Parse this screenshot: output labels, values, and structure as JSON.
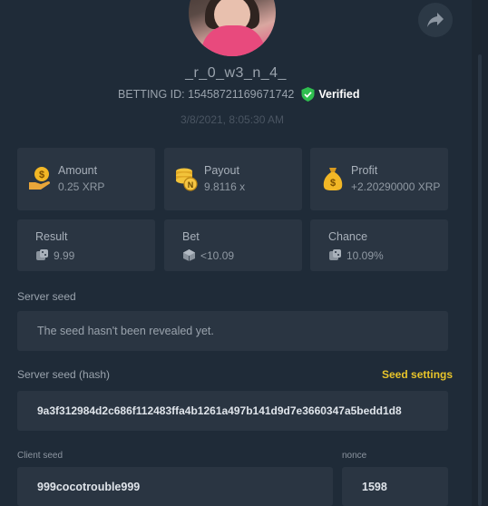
{
  "profile": {
    "username": "_r_0_w3_n_4_",
    "betting_id": "BETTING ID: 15458721169671742",
    "verified_label": "Verified",
    "timestamp": "3/8/2021, 8:05:30 AM"
  },
  "stats": {
    "amount": {
      "label": "Amount",
      "value": "0.25 XRP",
      "icon": "money-bag-hand-icon"
    },
    "payout": {
      "label": "Payout",
      "value": "9.8116 x",
      "icon": "coin-stack-icon"
    },
    "profit": {
      "label": "Profit",
      "value": "+2.20290000 XRP",
      "icon": "money-sack-icon"
    },
    "result": {
      "label": "Result",
      "value": "9.99",
      "icon": "dice-icon"
    },
    "bet": {
      "label": "Bet",
      "value": "<10.09",
      "icon": "cube-icon"
    },
    "chance": {
      "label": "Chance",
      "value": "10.09%",
      "icon": "dice-icon"
    }
  },
  "server_seed": {
    "label": "Server seed",
    "value": "The seed hasn't been revealed yet."
  },
  "server_seed_hash": {
    "label": "Server seed (hash)",
    "settings_link": "Seed settings",
    "value": "9a3f312984d2c686f112483ffa4b1261a497b141d9d7e3660347a5bedd1d8"
  },
  "client_seed": {
    "label": "Client seed",
    "value": "999cocotrouble999"
  },
  "nonce": {
    "label": "nonce",
    "value": "1598"
  },
  "colors": {
    "background": "#1f2b38",
    "card": "#2a3542",
    "accent_gold": "#e8c42a",
    "verified_green": "#2fbf4f"
  }
}
